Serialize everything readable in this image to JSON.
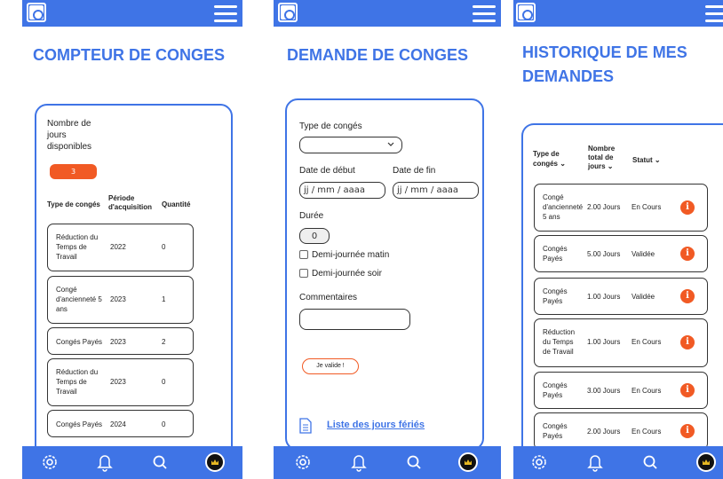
{
  "colors": {
    "primary": "#3f74e6",
    "accent": "#f15a24"
  },
  "compteur": {
    "title": "COMPTEUR DE CONGES",
    "jours_label_lines": [
      "Nombre de",
      "jours",
      "disponibles"
    ],
    "jours_value": "3",
    "headers": {
      "type": "Type de congés",
      "periode_lines": [
        "Période",
        "d'acquisition"
      ],
      "quantite": "Quantité"
    },
    "rows": [
      {
        "type_lines": [
          "Réduction du",
          "Temps de",
          "Travail"
        ],
        "periode": "2022",
        "quantite": "0"
      },
      {
        "type_lines": [
          "Congé",
          "d'ancienneté 5",
          "ans"
        ],
        "periode": "2023",
        "quantite": "1"
      },
      {
        "type_lines": [
          "Congés Payés"
        ],
        "periode": "2023",
        "quantite": "2"
      },
      {
        "type_lines": [
          "Réduction du",
          "Temps de",
          "Travail"
        ],
        "periode": "2023",
        "quantite": "0"
      },
      {
        "type_lines": [
          "Congés Payés"
        ],
        "periode": "2024",
        "quantite": "0"
      }
    ]
  },
  "demande": {
    "title": "DEMANDE DE CONGES",
    "type_label": "Type de congés",
    "date_debut_label": "Date de début",
    "date_fin_label": "Date de fin",
    "date_placeholder": "jj / mm / aaaa",
    "duree_label": "Durée",
    "duree_value": "0",
    "demi_matin": "Demi-journée matin",
    "demi_soir": "Demi-journée soir",
    "commentaires_label": "Commentaires",
    "submit": "Je valide !",
    "feries_link": "Liste des jours fériés"
  },
  "historique": {
    "title_lines": [
      "HISTORIQUE DE MES",
      "DEMANDES"
    ],
    "headers": {
      "type_lines": [
        "Type de",
        "congés"
      ],
      "total_lines": [
        "Nombre",
        "total de",
        "jours"
      ],
      "statut": "Statut"
    },
    "rows": [
      {
        "type_lines": [
          "Congé",
          "d'ancienneté",
          "5 ans"
        ],
        "total": "2.00 Jours",
        "statut": "En Cours"
      },
      {
        "type_lines": [
          "Congés",
          "Payés"
        ],
        "total": "5.00 Jours",
        "statut": "Validée"
      },
      {
        "type_lines": [
          "Congés",
          "Payés"
        ],
        "total": "1.00 Jours",
        "statut": "Validée"
      },
      {
        "type_lines": [
          "Réduction",
          "du Temps",
          "de Travail"
        ],
        "total": "1.00 Jours",
        "statut": "En Cours"
      },
      {
        "type_lines": [
          "Congés",
          "Payés"
        ],
        "total": "3.00 Jours",
        "statut": "En Cours"
      },
      {
        "type_lines": [
          "Congés",
          "Payés"
        ],
        "total": "2.00 Jours",
        "statut": "En Cours"
      }
    ],
    "info_glyph": "i"
  },
  "icons": [
    "logo-icon",
    "menu-icon",
    "gear-icon",
    "bell-icon",
    "search-icon",
    "avatar-crown-icon",
    "document-icon",
    "chevron-down-icon",
    "info-icon"
  ]
}
